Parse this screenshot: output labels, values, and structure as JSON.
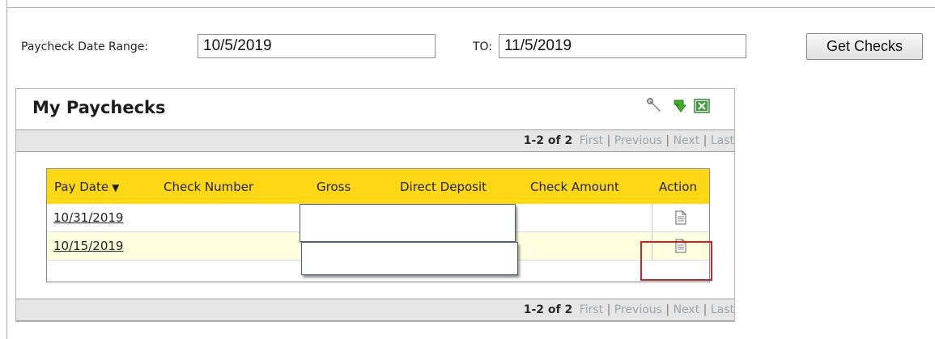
{
  "filters": {
    "range_label": "Paycheck Date Range:",
    "start_date": "10/5/2019",
    "to_label": "TO:",
    "end_date": "11/5/2019",
    "get_checks_label": "Get Checks"
  },
  "portlet": {
    "title": "My Paychecks",
    "pager": {
      "count": "1-2 of 2",
      "first": "First",
      "previous": "Previous",
      "next": "Next",
      "last": "Last",
      "separator": "|"
    },
    "table": {
      "columns": [
        "Pay Date",
        "Check Number",
        "Gross",
        "Direct Deposit",
        "Check Amount",
        "Action"
      ],
      "sort_indicator": "▼",
      "rows": [
        {
          "pay_date": "10/31/2019",
          "check_number": "",
          "gross": "",
          "direct_deposit": "",
          "check_amount": ""
        },
        {
          "pay_date": "10/15/2019",
          "check_number": "",
          "gross": "",
          "direct_deposit": "",
          "check_amount": ""
        }
      ]
    },
    "icons": [
      "wrench-icon",
      "refresh-icon",
      "excel-export-icon",
      "document-icon"
    ],
    "colors": {
      "header_yellow": "#ffd815",
      "row_alt": "#ffffe0",
      "pager_bg": "#e5e5e5",
      "highlight_red": "#cf2028",
      "pager_link": "#9aa6b2"
    }
  }
}
